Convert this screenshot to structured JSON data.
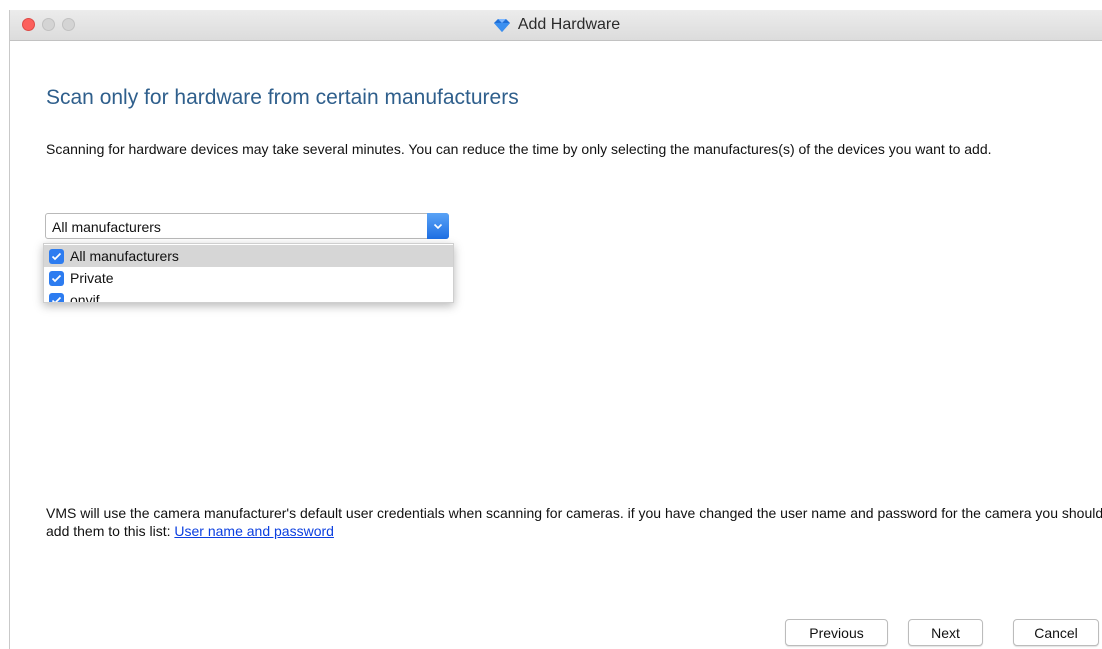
{
  "window": {
    "title": "Add Hardware",
    "title_icon": "diamond-icon",
    "accent_color": "#2f5f8c"
  },
  "page": {
    "heading": "Scan only for hardware from certain manufacturers",
    "description": "Scanning for hardware devices may take several minutes. You can reduce the time by only selecting the manufactures(s) of the devices you want to add."
  },
  "manufacturer_select": {
    "value": "All manufacturers",
    "options": [
      {
        "label": "All manufacturers",
        "checked": true,
        "highlighted": true
      },
      {
        "label": "Private",
        "checked": true,
        "highlighted": false
      },
      {
        "label": "onvif",
        "checked": true,
        "highlighted": false
      }
    ]
  },
  "notice": {
    "text": "VMS will use the camera manufacturer's default user credentials when scanning for cameras. if you have changed the user name and password for the camera you should add them to this list: ",
    "link_label": "User name and password",
    "link_color": "#0b3fe0"
  },
  "buttons": {
    "previous": "Previous",
    "next": "Next",
    "cancel": "Cancel"
  }
}
